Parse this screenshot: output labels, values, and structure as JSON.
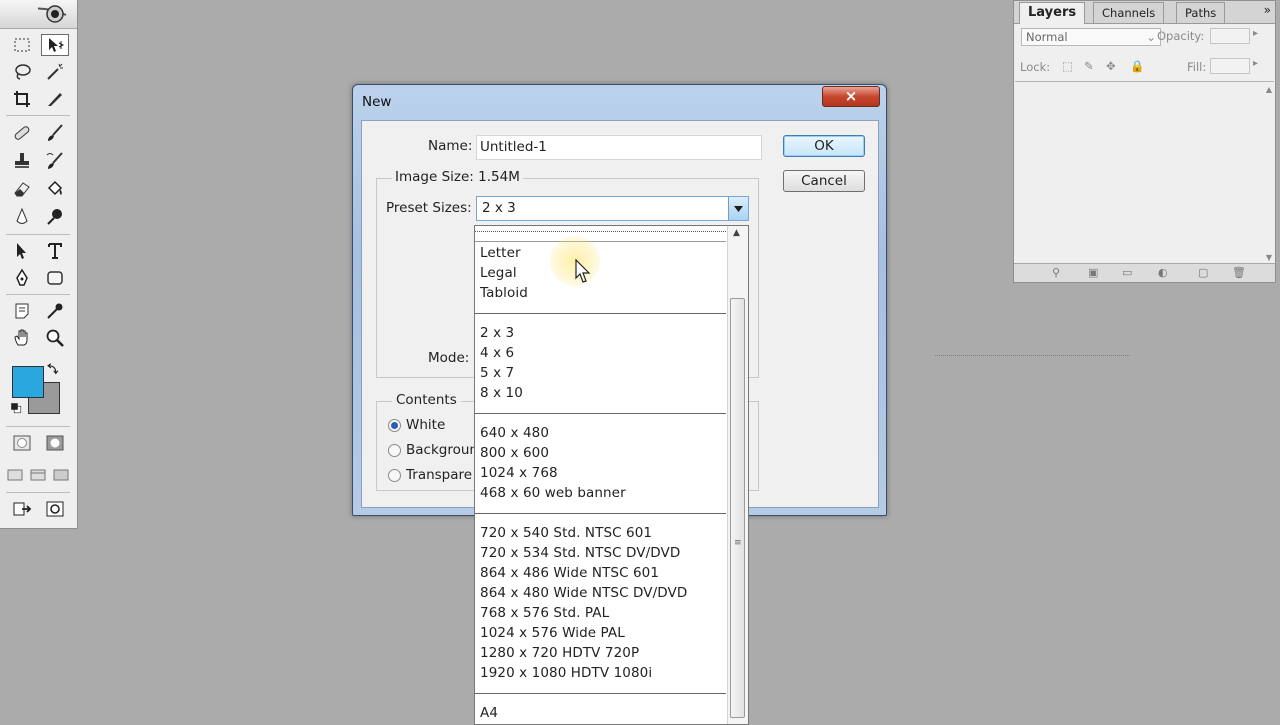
{
  "dialog": {
    "title": "New",
    "close_label": "×",
    "name_label": "Name:",
    "name_value": "Untitled-1",
    "image_size_label": "Image Size:",
    "image_size_value": "1.54M",
    "preset_sizes_label": "Preset Sizes:",
    "preset_value": "2 x 3",
    "mode_label": "Mode:",
    "ok_label": "OK",
    "cancel_label": "Cancel",
    "contents_label": "Contents",
    "contents_options": [
      "White",
      "Backgroun",
      "Transpare"
    ],
    "contents_selected": "White"
  },
  "preset_list": {
    "groups": [
      [
        "Letter",
        "Legal",
        "Tabloid"
      ],
      [
        "2 x 3",
        "4 x 6",
        "5 x 7",
        "8 x 10"
      ],
      [
        "640 x 480",
        "800 x 600",
        "1024 x 768",
        "468 x 60 web banner"
      ],
      [
        "720 x 540 Std. NTSC 601",
        "720 x 534 Std. NTSC DV/DVD",
        "864 x 486 Wide NTSC 601",
        "864 x 480 Wide NTSC DV/DVD",
        "768 x 576 Std. PAL",
        "1024 x 576 Wide PAL",
        "1280 x 720 HDTV 720P",
        "1920 x 1080 HDTV 1080i"
      ],
      [
        "A4"
      ]
    ]
  },
  "layers_palette": {
    "tabs": [
      "Layers",
      "Channels",
      "Paths"
    ],
    "active_tab": "Layers",
    "blend_mode": "Normal",
    "opacity_label": "Opacity:",
    "lock_label": "Lock:",
    "fill_label": "Fill:"
  },
  "toolbox": {
    "foreground_color": "#29a8e0",
    "background_color": "#9a9a9a"
  }
}
